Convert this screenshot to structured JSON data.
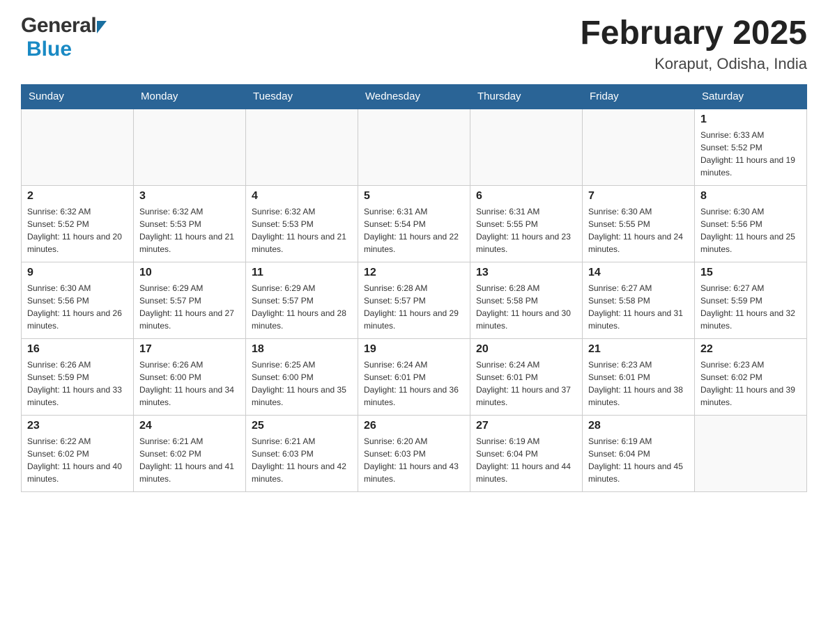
{
  "header": {
    "title": "February 2025",
    "subtitle": "Koraput, Odisha, India",
    "logo_general": "General",
    "logo_blue": "Blue"
  },
  "weekdays": [
    "Sunday",
    "Monday",
    "Tuesday",
    "Wednesday",
    "Thursday",
    "Friday",
    "Saturday"
  ],
  "weeks": [
    [
      {
        "day": "",
        "sunrise": "",
        "sunset": "",
        "daylight": ""
      },
      {
        "day": "",
        "sunrise": "",
        "sunset": "",
        "daylight": ""
      },
      {
        "day": "",
        "sunrise": "",
        "sunset": "",
        "daylight": ""
      },
      {
        "day": "",
        "sunrise": "",
        "sunset": "",
        "daylight": ""
      },
      {
        "day": "",
        "sunrise": "",
        "sunset": "",
        "daylight": ""
      },
      {
        "day": "",
        "sunrise": "",
        "sunset": "",
        "daylight": ""
      },
      {
        "day": "1",
        "sunrise": "Sunrise: 6:33 AM",
        "sunset": "Sunset: 5:52 PM",
        "daylight": "Daylight: 11 hours and 19 minutes."
      }
    ],
    [
      {
        "day": "2",
        "sunrise": "Sunrise: 6:32 AM",
        "sunset": "Sunset: 5:52 PM",
        "daylight": "Daylight: 11 hours and 20 minutes."
      },
      {
        "day": "3",
        "sunrise": "Sunrise: 6:32 AM",
        "sunset": "Sunset: 5:53 PM",
        "daylight": "Daylight: 11 hours and 21 minutes."
      },
      {
        "day": "4",
        "sunrise": "Sunrise: 6:32 AM",
        "sunset": "Sunset: 5:53 PM",
        "daylight": "Daylight: 11 hours and 21 minutes."
      },
      {
        "day": "5",
        "sunrise": "Sunrise: 6:31 AM",
        "sunset": "Sunset: 5:54 PM",
        "daylight": "Daylight: 11 hours and 22 minutes."
      },
      {
        "day": "6",
        "sunrise": "Sunrise: 6:31 AM",
        "sunset": "Sunset: 5:55 PM",
        "daylight": "Daylight: 11 hours and 23 minutes."
      },
      {
        "day": "7",
        "sunrise": "Sunrise: 6:30 AM",
        "sunset": "Sunset: 5:55 PM",
        "daylight": "Daylight: 11 hours and 24 minutes."
      },
      {
        "day": "8",
        "sunrise": "Sunrise: 6:30 AM",
        "sunset": "Sunset: 5:56 PM",
        "daylight": "Daylight: 11 hours and 25 minutes."
      }
    ],
    [
      {
        "day": "9",
        "sunrise": "Sunrise: 6:30 AM",
        "sunset": "Sunset: 5:56 PM",
        "daylight": "Daylight: 11 hours and 26 minutes."
      },
      {
        "day": "10",
        "sunrise": "Sunrise: 6:29 AM",
        "sunset": "Sunset: 5:57 PM",
        "daylight": "Daylight: 11 hours and 27 minutes."
      },
      {
        "day": "11",
        "sunrise": "Sunrise: 6:29 AM",
        "sunset": "Sunset: 5:57 PM",
        "daylight": "Daylight: 11 hours and 28 minutes."
      },
      {
        "day": "12",
        "sunrise": "Sunrise: 6:28 AM",
        "sunset": "Sunset: 5:57 PM",
        "daylight": "Daylight: 11 hours and 29 minutes."
      },
      {
        "day": "13",
        "sunrise": "Sunrise: 6:28 AM",
        "sunset": "Sunset: 5:58 PM",
        "daylight": "Daylight: 11 hours and 30 minutes."
      },
      {
        "day": "14",
        "sunrise": "Sunrise: 6:27 AM",
        "sunset": "Sunset: 5:58 PM",
        "daylight": "Daylight: 11 hours and 31 minutes."
      },
      {
        "day": "15",
        "sunrise": "Sunrise: 6:27 AM",
        "sunset": "Sunset: 5:59 PM",
        "daylight": "Daylight: 11 hours and 32 minutes."
      }
    ],
    [
      {
        "day": "16",
        "sunrise": "Sunrise: 6:26 AM",
        "sunset": "Sunset: 5:59 PM",
        "daylight": "Daylight: 11 hours and 33 minutes."
      },
      {
        "day": "17",
        "sunrise": "Sunrise: 6:26 AM",
        "sunset": "Sunset: 6:00 PM",
        "daylight": "Daylight: 11 hours and 34 minutes."
      },
      {
        "day": "18",
        "sunrise": "Sunrise: 6:25 AM",
        "sunset": "Sunset: 6:00 PM",
        "daylight": "Daylight: 11 hours and 35 minutes."
      },
      {
        "day": "19",
        "sunrise": "Sunrise: 6:24 AM",
        "sunset": "Sunset: 6:01 PM",
        "daylight": "Daylight: 11 hours and 36 minutes."
      },
      {
        "day": "20",
        "sunrise": "Sunrise: 6:24 AM",
        "sunset": "Sunset: 6:01 PM",
        "daylight": "Daylight: 11 hours and 37 minutes."
      },
      {
        "day": "21",
        "sunrise": "Sunrise: 6:23 AM",
        "sunset": "Sunset: 6:01 PM",
        "daylight": "Daylight: 11 hours and 38 minutes."
      },
      {
        "day": "22",
        "sunrise": "Sunrise: 6:23 AM",
        "sunset": "Sunset: 6:02 PM",
        "daylight": "Daylight: 11 hours and 39 minutes."
      }
    ],
    [
      {
        "day": "23",
        "sunrise": "Sunrise: 6:22 AM",
        "sunset": "Sunset: 6:02 PM",
        "daylight": "Daylight: 11 hours and 40 minutes."
      },
      {
        "day": "24",
        "sunrise": "Sunrise: 6:21 AM",
        "sunset": "Sunset: 6:02 PM",
        "daylight": "Daylight: 11 hours and 41 minutes."
      },
      {
        "day": "25",
        "sunrise": "Sunrise: 6:21 AM",
        "sunset": "Sunset: 6:03 PM",
        "daylight": "Daylight: 11 hours and 42 minutes."
      },
      {
        "day": "26",
        "sunrise": "Sunrise: 6:20 AM",
        "sunset": "Sunset: 6:03 PM",
        "daylight": "Daylight: 11 hours and 43 minutes."
      },
      {
        "day": "27",
        "sunrise": "Sunrise: 6:19 AM",
        "sunset": "Sunset: 6:04 PM",
        "daylight": "Daylight: 11 hours and 44 minutes."
      },
      {
        "day": "28",
        "sunrise": "Sunrise: 6:19 AM",
        "sunset": "Sunset: 6:04 PM",
        "daylight": "Daylight: 11 hours and 45 minutes."
      },
      {
        "day": "",
        "sunrise": "",
        "sunset": "",
        "daylight": ""
      }
    ]
  ]
}
